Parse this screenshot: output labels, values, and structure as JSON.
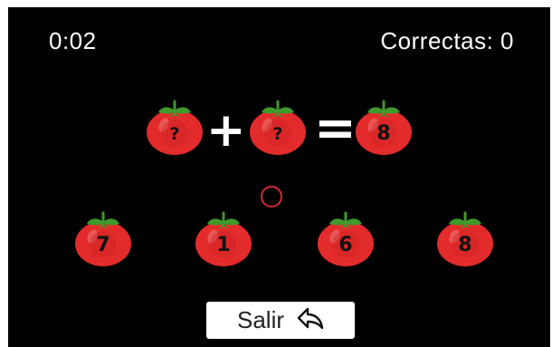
{
  "hud": {
    "timer": "0:02",
    "score": "Correctas: 0"
  },
  "equation": {
    "operand1": "?",
    "operator": "+",
    "operand2": "?",
    "equals": "=",
    "result": "8"
  },
  "options": [
    "7",
    "1",
    "6",
    "8"
  ],
  "exit_button": {
    "label": "Salir",
    "icon": "back-arrow-icon"
  },
  "colors": {
    "background": "#000000",
    "tomato_red": "#e32b2b",
    "leaf_green": "#3f9a2c",
    "text": "#ffffff"
  }
}
